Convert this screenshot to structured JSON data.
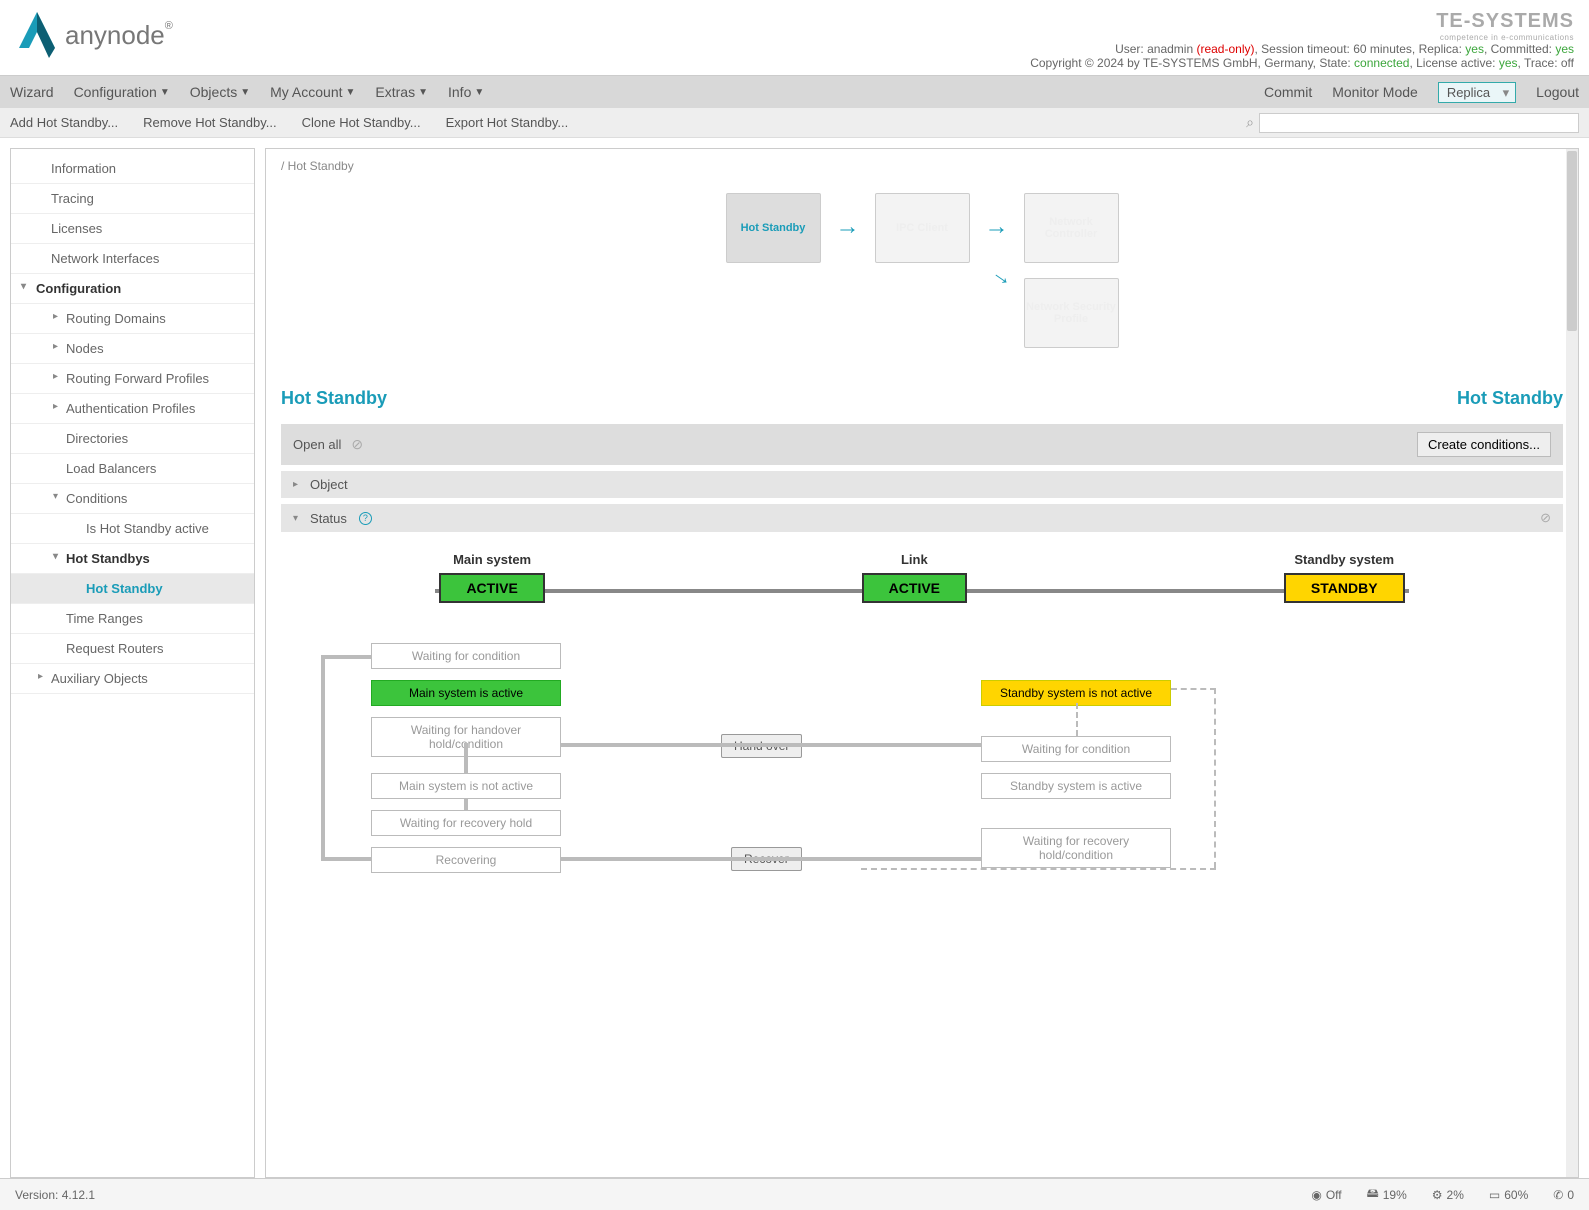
{
  "header": {
    "logo_text": "anynode",
    "brand": "TE-SYSTEMS",
    "brand_sub": "competence in e-communications",
    "user_line_prefix": "User: ",
    "user": "anadmin",
    "readonly": " (read-only)",
    "session": ", Session timeout: 60 minutes, Replica: ",
    "replica_val": "yes",
    "committed": ", Committed: ",
    "committed_val": "yes",
    "copyright": "Copyright © 2024 by TE-SYSTEMS GmbH, Germany, State: ",
    "state_val": "connected",
    "license": ", License active: ",
    "license_val": "yes",
    "trace": ", Trace: ",
    "trace_val": "off"
  },
  "menu": {
    "wizard": "Wizard",
    "configuration": "Configuration",
    "objects": "Objects",
    "account": "My Account",
    "extras": "Extras",
    "info": "Info",
    "commit": "Commit",
    "monitor": "Monitor Mode",
    "replica": "Replica",
    "logout": "Logout"
  },
  "toolbar": {
    "add": "Add Hot Standby...",
    "remove": "Remove Hot Standby...",
    "clone": "Clone Hot Standby...",
    "export": "Export Hot Standby..."
  },
  "sidebar": {
    "information": "Information",
    "tracing": "Tracing",
    "licenses": "Licenses",
    "network": "Network Interfaces",
    "configuration": "Configuration",
    "routing_domains": "Routing Domains",
    "nodes": "Nodes",
    "rfp": "Routing Forward Profiles",
    "auth": "Authentication Profiles",
    "directories": "Directories",
    "lb": "Load Balancers",
    "conditions": "Conditions",
    "is_hot": "Is Hot Standby active",
    "hot_standbys": "Hot Standbys",
    "hot_standby": "Hot Standby",
    "time_ranges": "Time Ranges",
    "request_routers": "Request Routers",
    "aux": "Auxiliary Objects"
  },
  "content": {
    "breadcrumb": "/ Hot Standby",
    "flow_hot": "Hot Standby",
    "flow_ipc": "IPC Client",
    "flow_net": "Network Controller",
    "flow_sec": "Network Security Profile",
    "title_left": "Hot Standby",
    "title_right": "Hot Standby",
    "open_all": "Open all",
    "create": "Create conditions...",
    "object": "Object",
    "status": "Status",
    "main_system": "Main system",
    "link": "Link",
    "standby_system": "Standby system",
    "active": "ACTIVE",
    "standby": "STANDBY",
    "states": {
      "waiting_cond": "Waiting for condition",
      "main_active": "Main system is active",
      "waiting_handover": "Waiting for handover hold/condition",
      "main_not_active": "Main system is not active",
      "waiting_recovery": "Waiting for recovery hold",
      "recovering": "Recovering",
      "standby_not_active": "Standby system is not active",
      "waiting_cond2": "Waiting for condition",
      "standby_active": "Standby system is active",
      "waiting_recovery_cond": "Waiting for recovery hold/condition",
      "hand_over": "Hand over",
      "recover": "Recover"
    }
  },
  "footer": {
    "version": "Version: 4.12.1",
    "off": "Off",
    "disk": "19%",
    "cpu": "2%",
    "mem": "60%",
    "calls": "0"
  }
}
